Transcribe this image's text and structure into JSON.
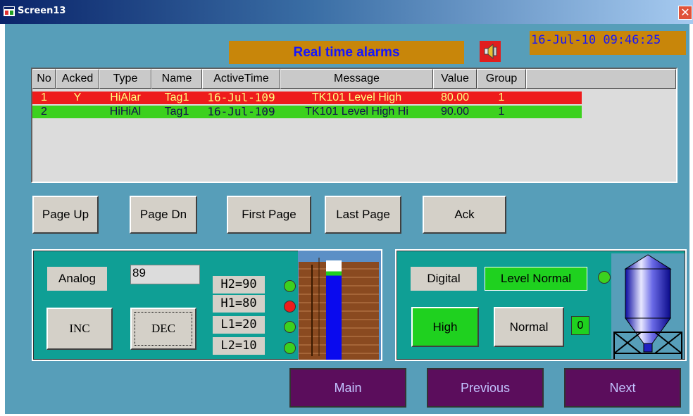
{
  "window": {
    "title": "Screen13"
  },
  "header": {
    "title": "Real time alarms",
    "datetime": "16-Jul-10 09:46:25"
  },
  "icons": {
    "app": "app-window-icon",
    "close": "close-icon",
    "speaker": "speaker-icon"
  },
  "alarm_table": {
    "columns": [
      "No",
      "Acked",
      "Type",
      "Name",
      "ActiveTime",
      "Message",
      "Value",
      "Group"
    ],
    "rows": [
      {
        "no": "1",
        "acked": "Y",
        "type": "HiAlar",
        "name": "Tag1",
        "active_time": "16-Jul-109",
        "message": "TK101 Level High",
        "value": "80.00",
        "group": "1",
        "color": "#ee1c1c"
      },
      {
        "no": "2",
        "acked": "",
        "type": "HiHiAl",
        "name": "Tag1",
        "active_time": "16-Jul-109",
        "message": "TK101 Level High Hi",
        "value": "90.00",
        "group": "1",
        "color": "#3cd11e"
      }
    ]
  },
  "paging": {
    "page_up": "Page Up",
    "page_dn": "Page Dn",
    "first_page": "First Page",
    "last_page": "Last Page",
    "ack": "Ack"
  },
  "analog_panel": {
    "label": "Analog",
    "value": "89",
    "inc": "INC",
    "dec": "DEC",
    "limits": [
      "H2=90",
      "H1=80",
      "L1=20",
      "L2=10"
    ],
    "indicators": [
      "#3cd11e",
      "#ee1c1c",
      "#3cd11e",
      "#3cd11e"
    ],
    "tank_level_percent": 89
  },
  "digital_panel": {
    "label": "Digital",
    "status": "Level Normal",
    "high": "High",
    "normal": "Normal",
    "state_value": "0"
  },
  "nav": {
    "main": "Main",
    "previous": "Previous",
    "next": "Next"
  },
  "colors": {
    "screen_bg": "#579eb9",
    "panel_bg": "#0f9f95",
    "accent": "#c8860a",
    "title_blue": "#1515ff",
    "nav_bg": "#5b0d5c"
  }
}
